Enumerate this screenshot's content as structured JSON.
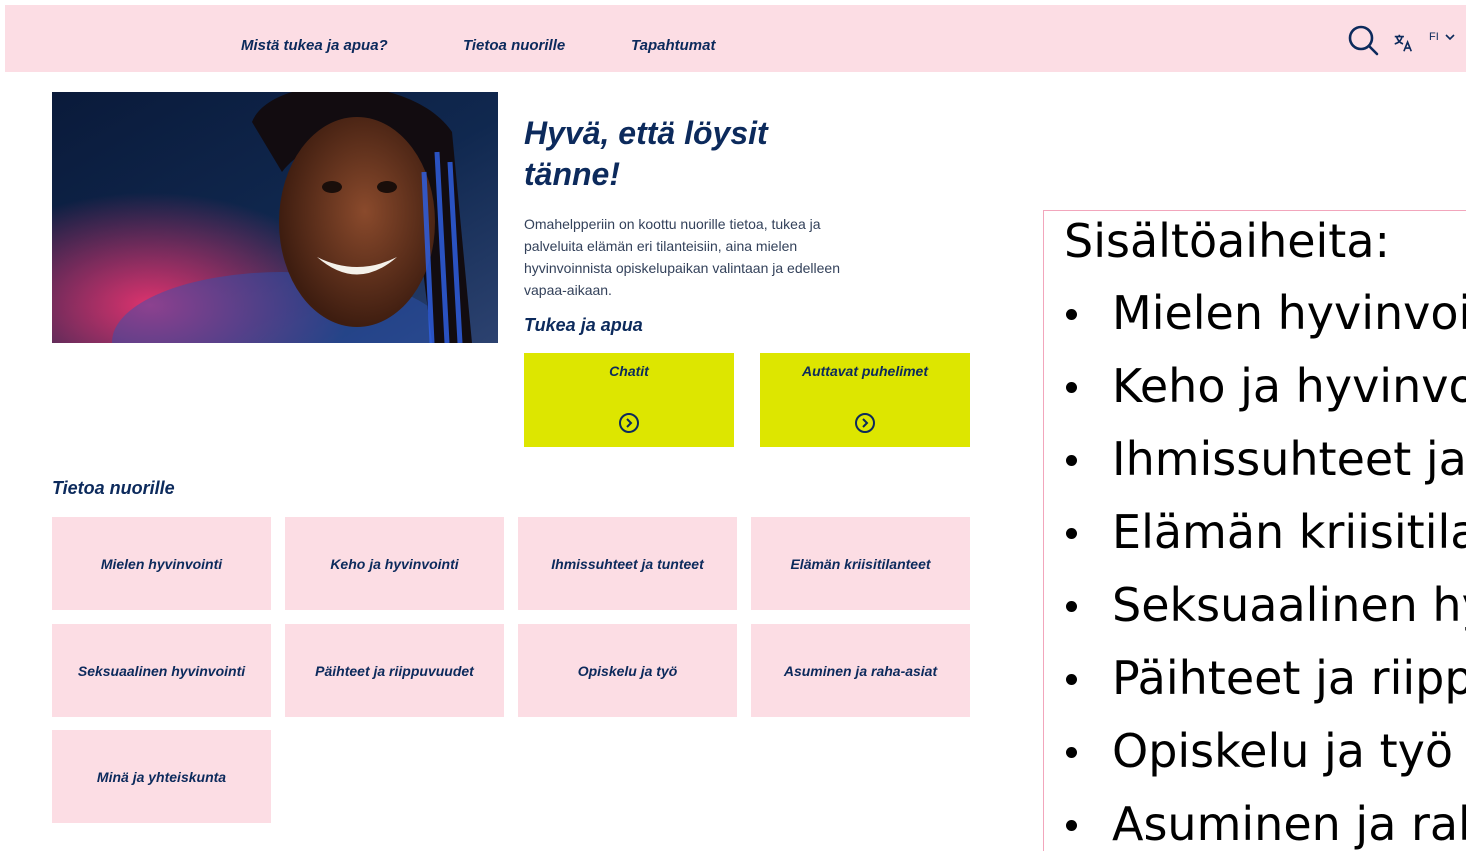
{
  "nav": {
    "items": [
      "Mistä tukea ja apua?",
      "Tietoa nuorille",
      "Tapahtumat"
    ],
    "language": "FI",
    "icons": [
      "search-icon",
      "translate-icon",
      "chevron-down-icon"
    ]
  },
  "hero": {
    "title": "Hyvä, että löysit tänne!",
    "description": "Omahelpperiin on koottu nuorille tietoa, tukea ja palveluita elämän eri tilanteisiin, aina mielen hyvinvoinnista opiskelupaikan valintaan ja edelleen vapaa-aikaan.",
    "support_heading": "Tukea ja apua",
    "cta": [
      {
        "label": "Chatit"
      },
      {
        "label": "Auttavat puhelimet"
      }
    ]
  },
  "topics": {
    "heading": "Tietoa nuorille",
    "tiles": [
      "Mielen hyvinvointi",
      "Keho ja hyvinvointi",
      "Ihmissuhteet ja tunteet",
      "Elämän kriisitilanteet",
      "Seksuaalinen hyvinvointi",
      "Päihteet ja riippuvuudet",
      "Opiskelu ja työ",
      "Asuminen ja raha-asiat",
      "Minä ja yhteiskunta"
    ]
  },
  "side_panel": {
    "title": "Sisältöaiheita:",
    "items": [
      "Mielen hyvinvointi",
      "Keho ja hyvinvointi",
      "Ihmissuhteet ja tunteet",
      "Elämän kriisitilanteet",
      "Seksuaalinen hyvinvointi",
      "Päihteet ja riippuvuudet",
      "Opiskelu ja työ",
      "Asuminen ja raha-asiat"
    ]
  },
  "colors": {
    "nav_bg": "#fcdde4",
    "tile_bg": "#fcdde4",
    "cta_bg": "#dde600",
    "text_primary": "#0c2a5c",
    "panel_border": "#f2a6bc"
  }
}
